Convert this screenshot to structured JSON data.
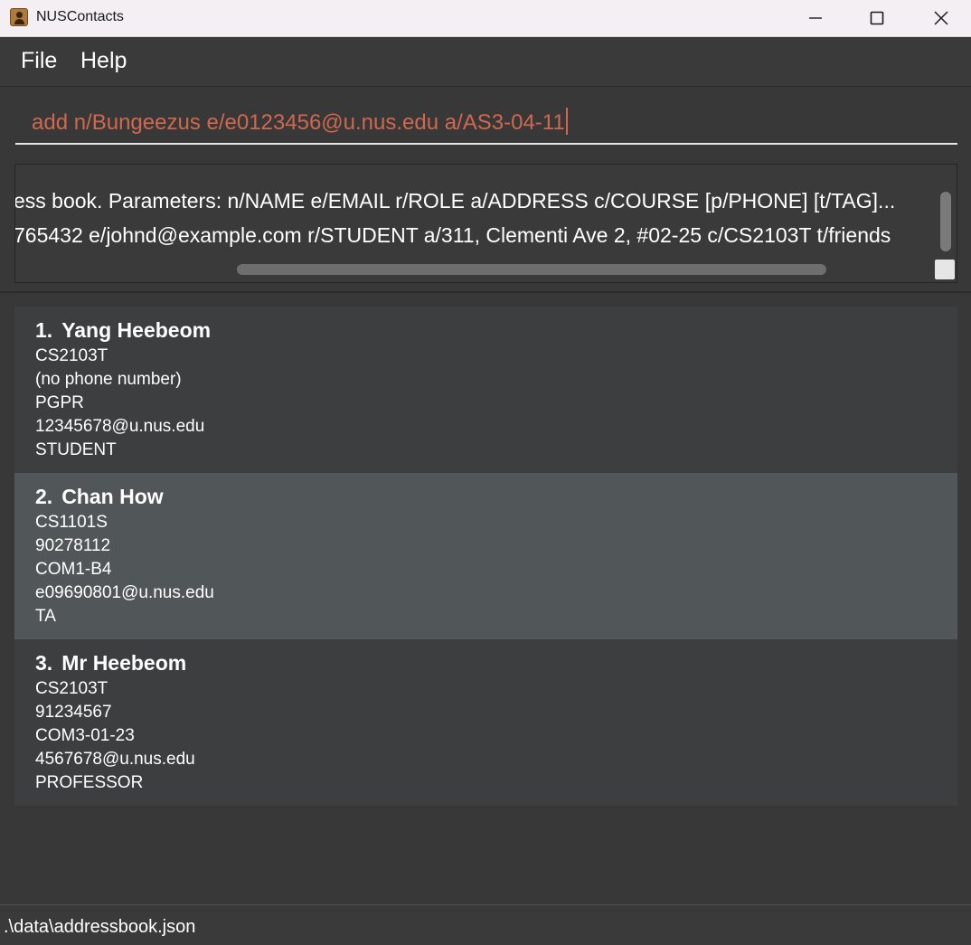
{
  "window": {
    "title": "NUSContacts",
    "icon": "address-book-icon",
    "controls": [
      "minimize-icon",
      "maximize-icon",
      "close-icon"
    ]
  },
  "menu": {
    "file_label": "File",
    "help_label": "Help"
  },
  "command_box": {
    "value": "add n/Bungeezus e/e0123456@u.nus.edu a/AS3-04-11",
    "text_color": "#d0684f"
  },
  "result_display": {
    "lines": [
      "ess book. Parameters: n/NAME e/EMAIL r/ROLE a/ADDRESS c/COURSE [p/PHONE] [t/TAG]...",
      "765432 e/johnd@example.com r/STUDENT a/311, Clementi Ave 2, #02-25 c/CS2103T t/friends"
    ]
  },
  "persons": [
    {
      "index": "1.",
      "name": "Yang Heebeom",
      "course": "CS2103T",
      "phone": "(no phone number)",
      "address": "PGPR",
      "email": "12345678@u.nus.edu",
      "role": "STUDENT",
      "selected": false
    },
    {
      "index": "2.",
      "name": "Chan How",
      "course": "CS1101S",
      "phone": "90278112",
      "address": "COM1-B4",
      "email": "e09690801@u.nus.edu",
      "role": "TA",
      "selected": true
    },
    {
      "index": "3.",
      "name": "Mr Heebeom",
      "course": "CS2103T",
      "phone": "91234567",
      "address": "COM3-01-23",
      "email": "4567678@u.nus.edu",
      "role": "PROFESSOR",
      "selected": false
    }
  ],
  "status_bar": {
    "file_path": ".\\data\\addressbook.json"
  },
  "colors": {
    "background": "#383838",
    "card": "#3c3e3f",
    "card_selected": "#515658",
    "titlebar": "#f3eff3"
  }
}
